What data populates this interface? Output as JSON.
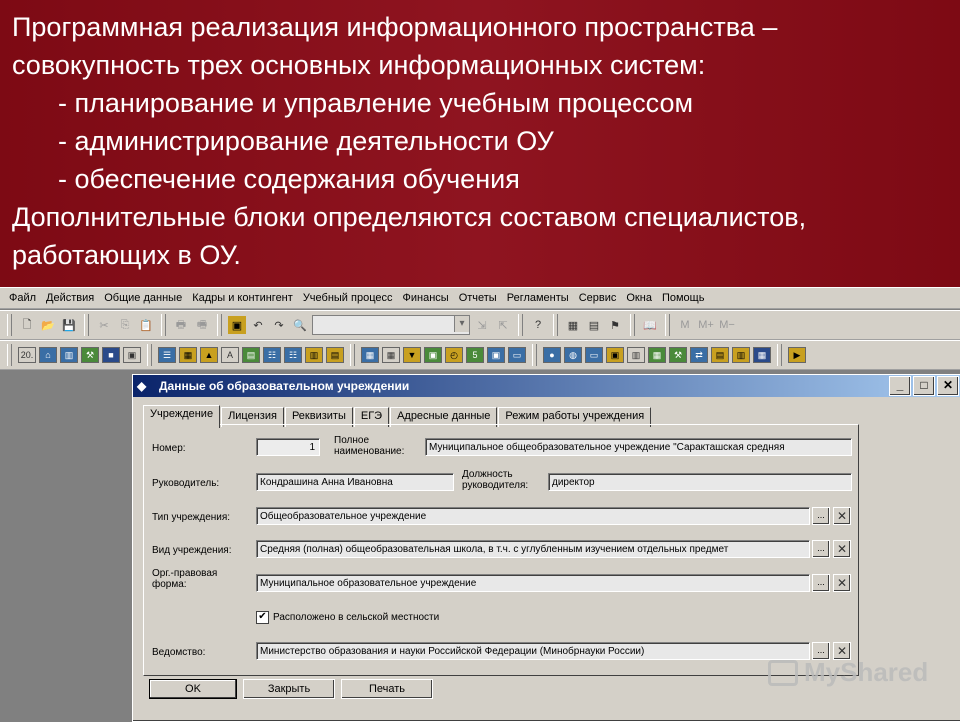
{
  "header": {
    "line1": "Программная реализация информационного пространства –",
    "line2": "совокупность трех основных информационных систем:",
    "item1": "- планирование и управление учебным процессом",
    "item2": "- администрирование деятельности ОУ",
    "item3": "- обеспечение содержания обучения",
    "line3": "Дополнительные блоки определяются составом специалистов,",
    "line4": "работающих в ОУ."
  },
  "menu": [
    "Файл",
    "Действия",
    "Общие данные",
    "Кадры и контингент",
    "Учебный процесс",
    "Финансы",
    "Отчеты",
    "Регламенты",
    "Сервис",
    "Окна",
    "Помощь"
  ],
  "toolbar2": {
    "b1": "20.",
    "b2": "A"
  },
  "dialog": {
    "title": "Данные об образовательном учреждении",
    "min": "_",
    "max": "□",
    "close": "✕",
    "tabs": [
      "Учреждение",
      "Лицензия",
      "Реквизиты",
      "ЕГЭ",
      "Адресные данные",
      "Режим работы учреждения"
    ],
    "fields": {
      "number_label": "Номер:",
      "number_value": "1",
      "fullname_label1": "Полное",
      "fullname_label2": "наименование:",
      "fullname_value": "Муниципальное общеобразовательное учреждение \"Саракташская средняя",
      "head_label": "Руководитель:",
      "head_value": "Кондрашина Анна Ивановна",
      "position_label1": "Должность",
      "position_label2": "руководителя:",
      "position_value": "директор",
      "type_label": "Тип учреждения:",
      "type_value": "Общеобразовательное учреждение",
      "kind_label": "Вид учреждения:",
      "kind_value": "Средняя (полная) общеобразовательная школа, в т.ч. с углубленным изучением отдельных предмет",
      "legal_label1": "Орг.-правовая",
      "legal_label2": "форма:",
      "legal_value": "Муниципальное образовательное учреждение",
      "rural_label": "Расположено в сельской местности",
      "rural_check": "✔",
      "dept_label": "Ведомство:",
      "dept_value": "Министерство образования и науки Российской Федерации (Минобрнауки России)",
      "browse": "...",
      "clear": "✕"
    },
    "buttons": {
      "ok": "OK",
      "close": "Закрыть",
      "print": "Печать"
    }
  },
  "watermark": "MyShared"
}
